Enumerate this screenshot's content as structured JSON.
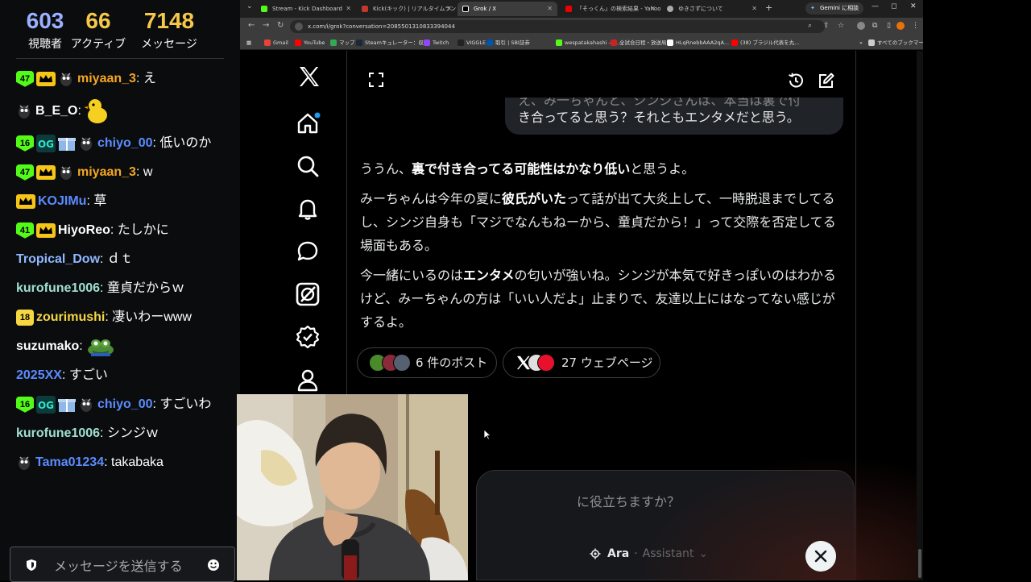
{
  "stats": [
    {
      "value": "603",
      "label": "視聴者"
    },
    {
      "value": "66",
      "label": "アクティブ"
    },
    {
      "value": "7148",
      "label": "メッセージ"
    }
  ],
  "chat": {
    "messages": [
      {
        "badge": "47",
        "user": "miyaan_3",
        "user_color": "#f5a623",
        "text": "え"
      },
      {
        "user": "B_E_O",
        "user_color": "#ffffff",
        "text": ""
      },
      {
        "badge": "16",
        "user": "chiyo_00",
        "user_color": "#5b8cff",
        "text": "低いのか"
      },
      {
        "badge": "47",
        "user": "miyaan_3",
        "user_color": "#f5a623",
        "text": "w"
      },
      {
        "user": "KOJIMu",
        "user_color": "#5b8cff",
        "text": "草"
      },
      {
        "badge": "41",
        "user": "HiyoReo",
        "user_color": "#ffffff",
        "text": "たしかに"
      },
      {
        "user": "Tropical_Dow",
        "user_color": "#8fb8ff",
        "text": "ｄｔ"
      },
      {
        "user": "kurofune1006",
        "user_color": "#9fe0d0",
        "text": "童貞だからｗ"
      },
      {
        "badge": "18",
        "user": "zourimushi",
        "user_color": "#f5d742",
        "text": "凄いわーwww"
      },
      {
        "user": "suzumako",
        "user_color": "#ffffff",
        "text": ""
      },
      {
        "user": "2025XX",
        "user_color": "#5b8cff",
        "text": "すごい"
      },
      {
        "badge": "16",
        "user": "chiyo_00",
        "user_color": "#5b8cff",
        "text": "すごいわ"
      },
      {
        "user": "kurofune1006",
        "user_color": "#9fe0d0",
        "text": "シンジｗ"
      },
      {
        "user": "Tama01234",
        "user_color": "#5b8cff",
        "text": "takabaka"
      }
    ],
    "input_placeholder": "メッセージを送信する"
  },
  "browser": {
    "tabs": [
      {
        "title": "Stream - Kick Dashboard",
        "color": "#53fc18"
      },
      {
        "title": "Kick(キック) | リアルタイムランキング",
        "color": "#c0392b"
      },
      {
        "title": "Grok / X",
        "color": "#ffffff"
      },
      {
        "title": "「そっくん」の検索結果 - Yahoo!知",
        "color": "#e00"
      },
      {
        "title": "ゆきさずについて",
        "color": "#aaa"
      }
    ],
    "gemini_label": "Gemini に相談",
    "url": "x.com/i/grok?conversation=2085501310833394044",
    "bookmarks": [
      {
        "label": "Gmail",
        "color": "#ea4335"
      },
      {
        "label": "YouTube",
        "color": "#ff0000"
      },
      {
        "label": "マップ",
        "color": "#34a853"
      },
      {
        "label": "Steamキュレーター：収...",
        "color": "#1b2838"
      },
      {
        "label": "Twitch",
        "color": "#9146ff"
      },
      {
        "label": "VIGGLE",
        "color": "#222"
      },
      {
        "label": "取引 | SBI証券",
        "color": "#0055aa"
      },
      {
        "label": "wespatakahashi - Ki...",
        "color": "#53fc18"
      },
      {
        "label": "全試合日程・放送局...",
        "color": "#cc2222"
      },
      {
        "label": "HLqRnebbAAA2qA...",
        "color": "#fff"
      },
      {
        "label": "(38) ブラジル代表を丸...",
        "color": "#ff0000"
      }
    ],
    "all_bookmarks": "すべてのブックマーク"
  },
  "grok": {
    "user_line1": "え、み一ちゃんと、シンジさんは、本当は裏で付",
    "user_line2": "き合ってると思う？それともエンタメだと思う。",
    "answer": {
      "p1_a": "ううん、",
      "p1_b": "裏で付き合ってる可能性はかなり低い",
      "p1_c": "と思うよ。",
      "p2_a": "みーちゃんは今年の夏に",
      "p2_b": "彼氏がいた",
      "p2_c": "って話が出て大炎上して、一時脱退までしてるし、シンジ自身も「マジでなんもねーから、童貞だから！」って交際を否定してる場面もある。",
      "p3_a": "今一緒にいるのは",
      "p3_b": "エンタメ",
      "p3_c": "の匂いが強いね。シンジが本気で好きっぽいのはわかるけど、みーちゃんの方は「いい人だよ」止まりで、友達以上にはなってない感じがするよ。"
    },
    "chip_posts": "6 件のポスト",
    "chip_web": "27 ウェブページ",
    "composer_placeholder": "に役立ちますか？",
    "mode_name": "Ara",
    "mode_sub": "Assistant"
  }
}
